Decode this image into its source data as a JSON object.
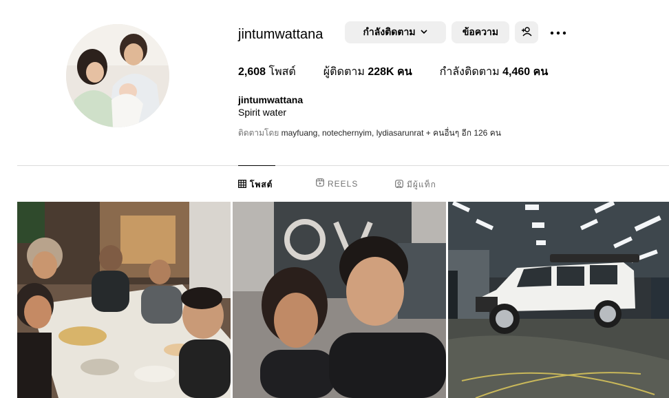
{
  "profile": {
    "username": "jintumwattana",
    "full_name": "jintumwattana",
    "bio": "Spirit water",
    "followed_by_prefix": "ติดตามโดย",
    "followed_by_names": "mayfuang, notechernyim, lydiasarunrat",
    "followed_by_suffix": "+ คนอื่นๆ อีก 126 คน"
  },
  "actions": {
    "following_label": "กำลังติดตาม",
    "message_label": "ข้อความ"
  },
  "stats": {
    "posts": "2,608",
    "posts_label": "โพสต์",
    "followers_label": "ผู้ติดตาม",
    "followers": "228K",
    "followers_unit": "คน",
    "following_label": "กำลังติดตาม",
    "following": "4,460",
    "following_unit": "คน"
  },
  "tabs": [
    {
      "label": "โพสต์",
      "icon": "grid-icon",
      "active": true
    },
    {
      "label": "REELS",
      "icon": "reels-icon",
      "active": false
    },
    {
      "label": "มีผู้แท็ก",
      "icon": "tagged-icon",
      "active": false
    }
  ],
  "posts": [
    {
      "subject": "group-dinner-photo"
    },
    {
      "subject": "couple-selfie-photo"
    },
    {
      "subject": "white-suv-garage-photo"
    }
  ]
}
